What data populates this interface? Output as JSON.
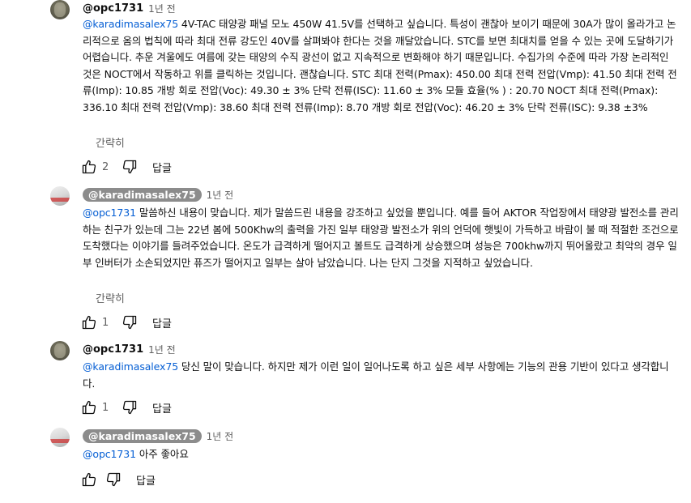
{
  "comments": [
    {
      "author": "@opc1731",
      "time": "1년 전",
      "mention": "@karadimasalex75",
      "text": " 4V-TAC 태양광 패널 모노 450W 41.5V를 선택하고 싶습니다. 특성이 괜찮아 보이기 때문에 30A가 많이 올라가고 논리적으로 옴의 법칙에 따라 최대 전류 강도인 40V를 살펴봐야 한다는 것을 깨달았습니다. STC를 보면 최대치를 얻을 수 있는 곳에 도달하기가 어렵습니다. 추운 겨울에도 여름에 갖는 태양의 수직 광선이 없고 지속적으로 변화해야 하기 때문입니다. 수집가의 수준에 따라 가장 논리적인 것은 NOCT에서 작동하고 위를 클릭하는 것입니다. 괜찮습니다. STC 최대 전력(Pmax): 450.00 최대 전력 전압(Vmp): 41.50 최대 전력 전류(Imp): 10.85 개방 회로 전압(Voc): 49.30 ± 3% 단락 전류(ISC): 11.60 ± 3% 모듈 효율(% ) : 20.70 NOCT 최대 전력(Pmax): 336.10 최대 전력 전압(Vmp): 38.60 최대 전력 전류(Imp): 8.70 개방 회로 전압(Voc): 46.20 ± 3% 단락 전류(ISC): 9.38 ±3%",
      "show_less": "간략히",
      "likes": "2",
      "reply": "답글"
    },
    {
      "author": "@karadimasalex75",
      "time": "1년 전",
      "mention": "@opc1731",
      "text": " 말씀하신 내용이 맞습니다. 제가 말씀드린 내용을 강조하고 싶었을 뿐입니다. 예를 들어 AKTOR 작업장에서 태양광 발전소를 관리하는 친구가 있는데 그는 22년 봄에 500Khw의 출력을 가진 일부 태양광 발전소가 위의 언덕에 햇빛이 가득하고 바람이 불 때 적절한 조건으로 도착했다는 이야기를 들려주었습니다. 온도가 급격하게 떨어지고 볼트도 급격하게 상승했으며 성능은 700khw까지 뛰어올랐고 최악의 경우 일부 인버터가 소손되었지만 퓨즈가 떨어지고 일부는 살아 남았습니다. 나는 단지 그것을 지적하고 싶었습니다.",
      "show_less": "간략히",
      "likes": "1",
      "reply": "답글"
    },
    {
      "author": "@opc1731",
      "time": "1년 전",
      "mention": "@karadimasalex75",
      "text": " 당신 말이 맞습니다. 하지만 제가 이런 일이 일어나도록 하고 싶은 세부 사항에는 기능의 관용 기반이 있다고 생각합니다.",
      "likes": "1",
      "reply": "답글"
    },
    {
      "author": "@karadimasalex75",
      "time": "1년 전",
      "mention": "@opc1731",
      "text": " 아주 좋아요",
      "likes": "",
      "reply": "답글"
    }
  ]
}
